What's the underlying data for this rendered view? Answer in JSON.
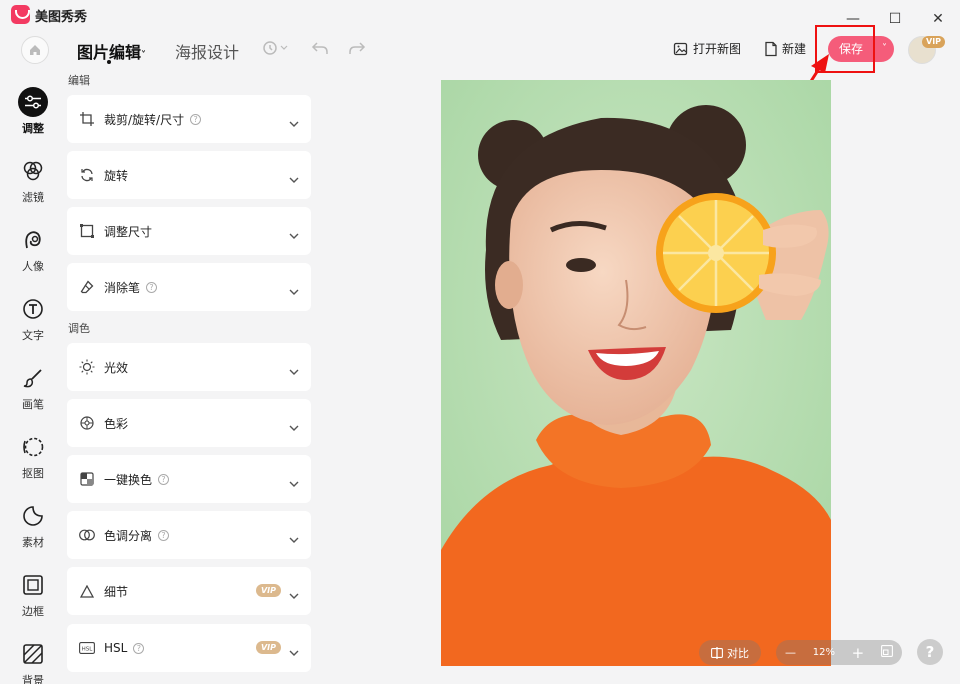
{
  "app": {
    "name": "美图秀秀"
  },
  "window_controls": {
    "minimize": "—",
    "maximize": "☐",
    "close": "✕"
  },
  "toolbar": {
    "tab_image_edit": "图片编辑",
    "tab_poster": "海报设计",
    "open_new": "打开新图",
    "new_label": "新建",
    "save_label": "保存",
    "vip": "VIP"
  },
  "sidebar": {
    "items": [
      {
        "label": "调整",
        "icon": "sliders-icon",
        "active": true
      },
      {
        "label": "滤镜",
        "icon": "filter-circles-icon"
      },
      {
        "label": "人像",
        "icon": "portrait-icon"
      },
      {
        "label": "文字",
        "icon": "text-icon"
      },
      {
        "label": "画笔",
        "icon": "brush-icon"
      },
      {
        "label": "抠图",
        "icon": "cutout-icon"
      },
      {
        "label": "素材",
        "icon": "sticker-icon"
      },
      {
        "label": "边框",
        "icon": "frame-icon"
      },
      {
        "label": "背景",
        "icon": "background-icon"
      }
    ]
  },
  "panel": {
    "section_edit": "编辑",
    "section_color": "调色",
    "items": [
      {
        "label": "裁剪/旋转/尺寸",
        "help": "?"
      },
      {
        "label": "旋转"
      },
      {
        "label": "调整尺寸"
      },
      {
        "label": "消除笔",
        "help": "?"
      },
      {
        "label": "光效"
      },
      {
        "label": "色彩"
      },
      {
        "label": "一键换色",
        "help": "?"
      },
      {
        "label": "色调分离",
        "help": "?"
      },
      {
        "label": "细节",
        "vip": "VIP"
      },
      {
        "label": "HSL",
        "help": "?",
        "vip": "VIP"
      }
    ]
  },
  "canvas": {
    "compare_label": "对比",
    "zoom_minus": "—",
    "zoom_level": "12%",
    "zoom_plus": "+",
    "help": "?"
  },
  "colors": {
    "accent": "#f55c7a",
    "highlight": "#ee1111",
    "vip": "#dcb98e"
  }
}
